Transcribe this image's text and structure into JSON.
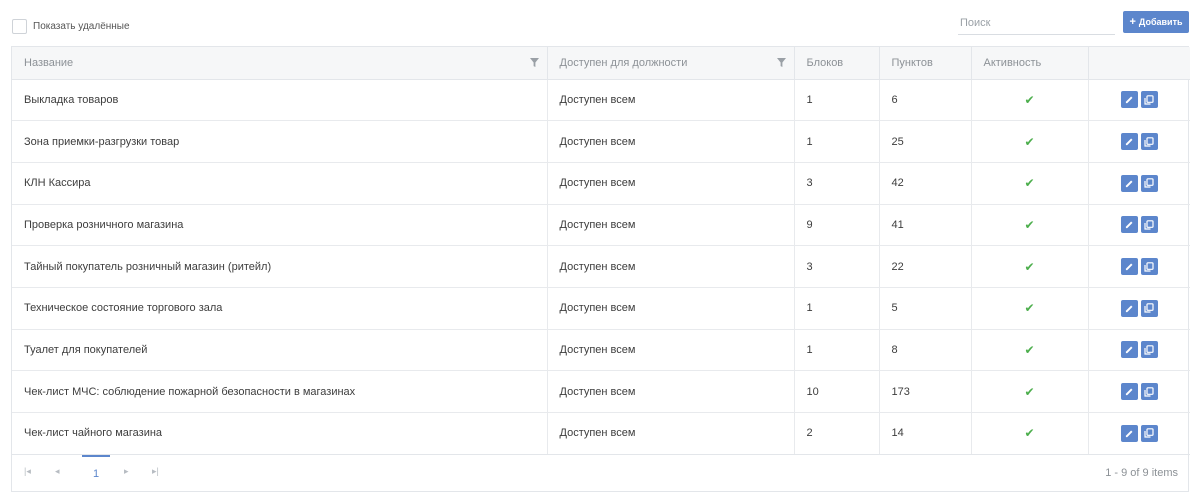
{
  "toolbar": {
    "show_deleted_label": "Показать удалённые",
    "search_placeholder": "Поиск",
    "add_label": "Добавить",
    "accent_color": "#5c86cc"
  },
  "table": {
    "columns": [
      "Название",
      "Доступен для должности",
      "Блоков",
      "Пунктов",
      "Активность",
      ""
    ],
    "rows": [
      {
        "name": "Выкладка товаров",
        "position": "Доступен всем",
        "blocks": "1",
        "items": "6",
        "active": true
      },
      {
        "name": "Зона приемки-разгрузки товар",
        "position": "Доступен всем",
        "blocks": "1",
        "items": "25",
        "active": true
      },
      {
        "name": "КЛН Кассира",
        "position": "Доступен всем",
        "blocks": "3",
        "items": "42",
        "active": true
      },
      {
        "name": "Проверка розничного магазина",
        "position": "Доступен всем",
        "blocks": "9",
        "items": "41",
        "active": true
      },
      {
        "name": "Тайный покупатель розничный магазин (ритейл)",
        "position": "Доступен всем",
        "blocks": "3",
        "items": "22",
        "active": true
      },
      {
        "name": "Техническое состояние торгового зала",
        "position": "Доступен всем",
        "blocks": "1",
        "items": "5",
        "active": true
      },
      {
        "name": "Туалет для покупателей",
        "position": "Доступен всем",
        "blocks": "1",
        "items": "8",
        "active": true
      },
      {
        "name": "Чек-лист МЧС: соблюдение пожарной безопасности в магазинах",
        "position": "Доступен всем",
        "blocks": "10",
        "items": "173",
        "active": true
      },
      {
        "name": "Чек-лист чайного магазина",
        "position": "Доступен всем",
        "blocks": "2",
        "items": "14",
        "active": true
      }
    ]
  },
  "pager": {
    "first": "|◂",
    "prev": "◂",
    "page": "1",
    "next": "▸",
    "last": "▸|",
    "info": "1 - 9 of 9 items"
  }
}
